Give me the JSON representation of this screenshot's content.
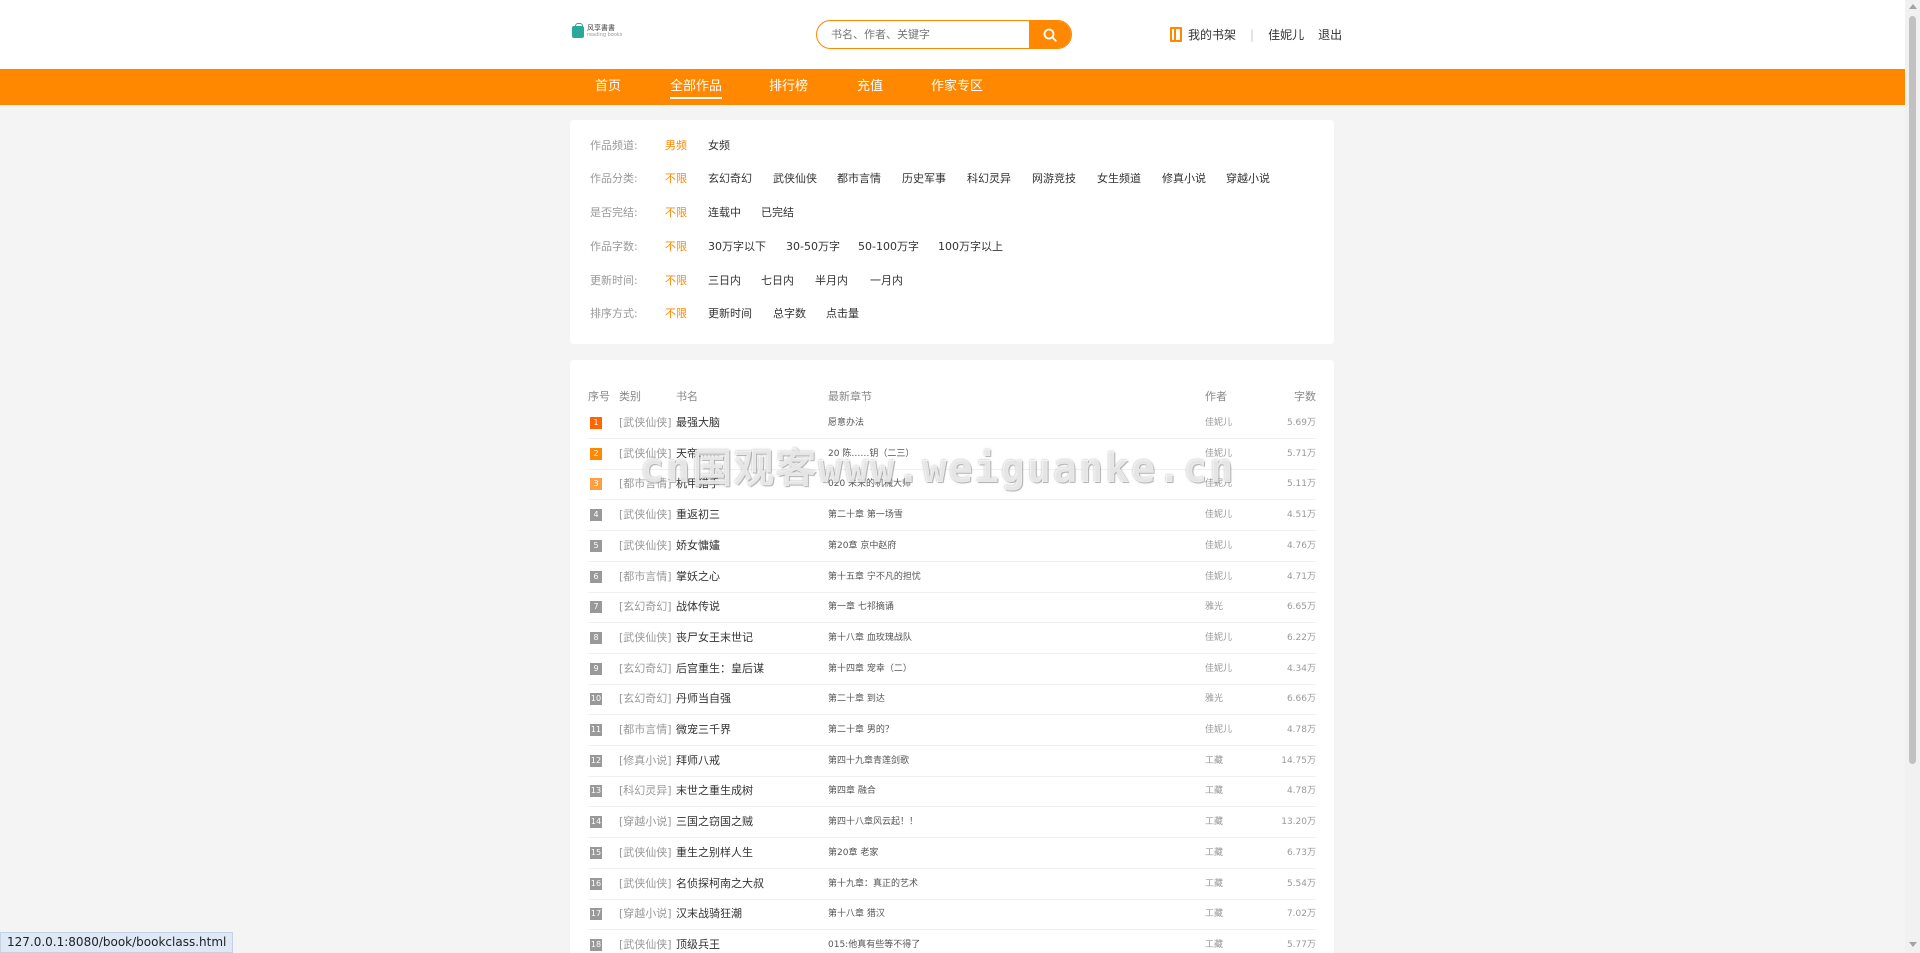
{
  "header": {
    "logo_cn": "风享書書",
    "logo_en": "reading books",
    "search_placeholder": "书名、作者、关键字",
    "bookshelf": "我的书架",
    "separator": "|",
    "username": "佳妮儿",
    "logout": "退出"
  },
  "nav": [
    "首页",
    "全部作品",
    "排行榜",
    "充值",
    "作家专区"
  ],
  "nav_active": "全部作品",
  "filters": [
    {
      "label": "作品频道:",
      "options": [
        "男频",
        "女频"
      ]
    },
    {
      "label": "作品分类:",
      "options": [
        "不限",
        "玄幻奇幻",
        "武侠仙侠",
        "都市言情",
        "历史军事",
        "科幻灵异",
        "网游竞技",
        "女生频道",
        "修真小说",
        "穿越小说"
      ]
    },
    {
      "label": "是否完结:",
      "options": [
        "不限",
        "连载中",
        "已完结"
      ]
    },
    {
      "label": "作品字数:",
      "options": [
        "不限",
        "30万字以下",
        "30-50万字",
        "50-100万字",
        "100万字以上"
      ]
    },
    {
      "label": "更新时间:",
      "options": [
        "不限",
        "三日内",
        "七日内",
        "半月内",
        "一月内"
      ]
    },
    {
      "label": "排序方式:",
      "options": [
        "不限",
        "更新时间",
        "总字数",
        "点击量"
      ]
    }
  ],
  "list_headers": {
    "rank": "序号",
    "category": "类别",
    "title": "书名",
    "chapter": "最新章节",
    "author": "作者",
    "words": "字数"
  },
  "books": [
    {
      "rank": "1",
      "category": "[武侠仙侠]",
      "title": "最强大脑",
      "chapter": "愿意办法",
      "author": "佳妮儿",
      "words": "5.69万"
    },
    {
      "rank": "2",
      "category": "[武侠仙侠]",
      "title": "天帝……",
      "chapter": "20 陈……钥（二三）",
      "author": "佳妮儿",
      "words": "5.71万"
    },
    {
      "rank": "3",
      "category": "[都市言情]",
      "title": "机甲猎手",
      "chapter": "020 未来的机械大师",
      "author": "佳妮儿",
      "words": "5.11万"
    },
    {
      "rank": "4",
      "category": "[武侠仙侠]",
      "title": "重返初三",
      "chapter": "第二十章 第一场雪",
      "author": "佳妮儿",
      "words": "4.51万"
    },
    {
      "rank": "5",
      "category": "[武侠仙侠]",
      "title": "娇女慵嫿",
      "chapter": "第20章 京中赵府",
      "author": "佳妮儿",
      "words": "4.76万"
    },
    {
      "rank": "6",
      "category": "[都市言情]",
      "title": "掌妖之心",
      "chapter": "第十五章 宁不凡的担忧",
      "author": "佳妮儿",
      "words": "4.71万"
    },
    {
      "rank": "7",
      "category": "[玄幻奇幻]",
      "title": "战体传说",
      "chapter": "第一章 七祁摘诵",
      "author": "雅光",
      "words": "6.65万"
    },
    {
      "rank": "8",
      "category": "[武侠仙侠]",
      "title": "丧尸女王末世记",
      "chapter": "第十八章 血玫瑰战队",
      "author": "佳妮儿",
      "words": "6.22万"
    },
    {
      "rank": "9",
      "category": "[玄幻奇幻]",
      "title": "后宫重生：皇后谋",
      "chapter": "第十四章 宠幸（二）",
      "author": "佳妮儿",
      "words": "4.34万"
    },
    {
      "rank": "10",
      "category": "[玄幻奇幻]",
      "title": "丹师当自强",
      "chapter": "第二十章 到达",
      "author": "雅光",
      "words": "6.66万"
    },
    {
      "rank": "11",
      "category": "[都市言情]",
      "title": "微宠三千界",
      "chapter": "第二十章 男的？",
      "author": "佳妮儿",
      "words": "4.78万"
    },
    {
      "rank": "12",
      "category": "[修真小说]",
      "title": "拜师八戒",
      "chapter": "第四十九章青莲剑歌",
      "author": "工藏",
      "words": "14.75万"
    },
    {
      "rank": "13",
      "category": "[科幻灵异]",
      "title": "末世之重生成树",
      "chapter": "第四章 融合",
      "author": "工藏",
      "words": "4.78万"
    },
    {
      "rank": "14",
      "category": "[穿越小说]",
      "title": "三国之窃国之贼",
      "chapter": "第四十八章风云起！！",
      "author": "工藏",
      "words": "13.20万"
    },
    {
      "rank": "15",
      "category": "[武侠仙侠]",
      "title": "重生之别样人生",
      "chapter": "第20章 老家",
      "author": "工藏",
      "words": "6.73万"
    },
    {
      "rank": "16",
      "category": "[武侠仙侠]",
      "title": "名侦探柯南之大叔",
      "chapter": "第十九章：真正的艺术",
      "author": "工藏",
      "words": "5.54万"
    },
    {
      "rank": "17",
      "category": "[穿越小说]",
      "title": "汉末战骑狂潮",
      "chapter": "第十八章 猎汉",
      "author": "工藏",
      "words": "7.02万"
    },
    {
      "rank": "18",
      "category": "[武侠仙侠]",
      "title": "顶级兵王",
      "chapter": "015:他真有些等不得了",
      "author": "工藏",
      "words": "5.77万"
    }
  ],
  "watermark": "cn国观客www.weiguanke.cn",
  "status_url": "127.0.0.1:8080/book/bookclass.html",
  "colors": {
    "accent": "#ff8800",
    "background": "#f4f4f4"
  }
}
